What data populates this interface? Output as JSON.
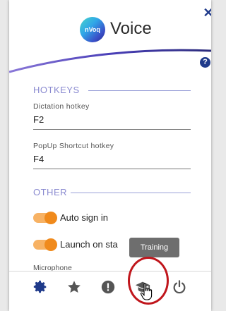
{
  "app": {
    "logo_text": "nVoq",
    "title": "Voice",
    "close": "✕",
    "help": "?"
  },
  "hotkeys": {
    "section_label": "HOTKEYS",
    "dictation_label": "Dictation hotkey",
    "dictation_value": "F2",
    "popup_label": "PopUp Shortcut hotkey",
    "popup_value": "F4"
  },
  "other": {
    "section_label": "OTHER",
    "auto_sign_in_label": "Auto sign in",
    "auto_sign_in_on": true,
    "launch_on_startup_label": "Launch on sta",
    "launch_on_startup_on": true,
    "microphone_label": "Microphone"
  },
  "tooltip": {
    "text": "Training"
  },
  "bottom_bar": {
    "icons": [
      "gear-icon",
      "star-icon",
      "alert-icon",
      "graduation-cap-icon",
      "power-icon"
    ]
  },
  "colors": {
    "brand_blue": "#1f3a8a",
    "toggle_orange": "#f08a1c",
    "section_color": "#8a8ad0",
    "highlight_red": "#c0161c"
  }
}
